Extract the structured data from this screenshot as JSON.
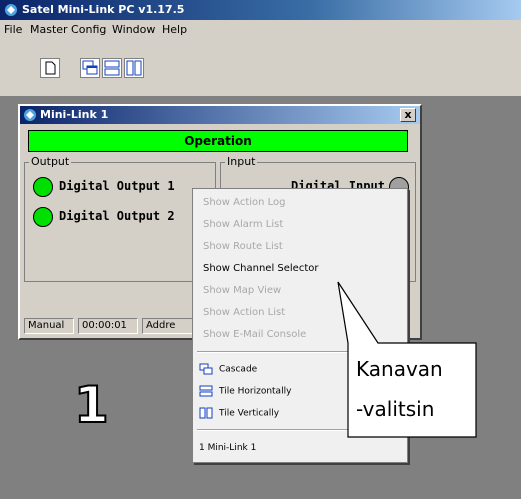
{
  "app": {
    "title": "Satel Mini-Link PC v1.17.5"
  },
  "menu": {
    "items": [
      "File",
      "Master Config",
      "Window",
      "Help"
    ]
  },
  "toolbar": {
    "buttons": [
      "new-icon",
      "cascade-icon",
      "tile-horizontally-icon",
      "tile-vertically-icon"
    ]
  },
  "child_window": {
    "title": "Mini-Link 1",
    "close_label": "x",
    "status_bar_label": "Operation",
    "status_bar_color": "#00ff00",
    "output_group": {
      "label": "Output",
      "items": [
        {
          "label": "Digital Output 1",
          "led_color": "#00e000"
        },
        {
          "label": "Digital Output 2",
          "led_color": "#00e000"
        }
      ]
    },
    "input_group": {
      "label": "Input",
      "items": [
        {
          "label": "Digital Input 1",
          "led_color": "#a0a0a0"
        }
      ]
    },
    "status_panels": [
      "Manual",
      "00:00:01",
      "Addre"
    ]
  },
  "context_menu": {
    "items": [
      {
        "label": "Show Action Log",
        "enabled": false
      },
      {
        "label": "Show Alarm List",
        "enabled": false
      },
      {
        "label": "Show Route List",
        "enabled": false
      },
      {
        "label": "Show Channel Selector",
        "enabled": true
      },
      {
        "label": "Show Map View",
        "enabled": false
      },
      {
        "label": "Show Action List",
        "enabled": false
      },
      {
        "label": "Show E-Mail Console",
        "enabled": false
      }
    ],
    "window_items": [
      {
        "label": "Cascade",
        "icon": "cascade-icon"
      },
      {
        "label": "Tile Horizontally",
        "icon": "tile-horizontally-icon"
      },
      {
        "label": "Tile Vertically",
        "icon": "tile-vertically-icon"
      }
    ],
    "open_windows": [
      "1 Mini-Link 1"
    ]
  },
  "annotation": {
    "callout_line1": "Kanavan",
    "callout_line2": "-valitsin",
    "step_number": "1"
  }
}
